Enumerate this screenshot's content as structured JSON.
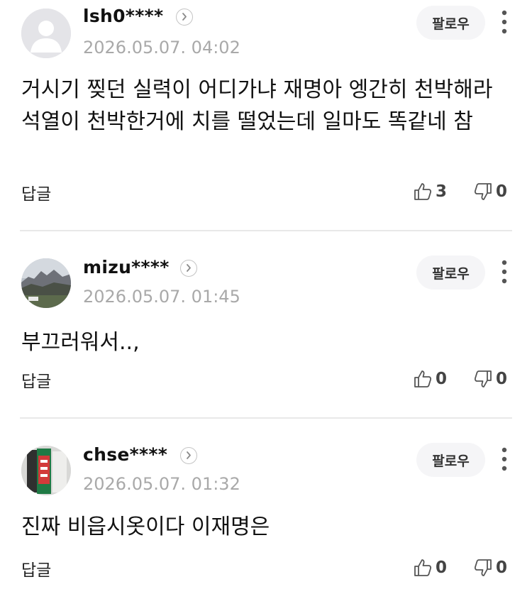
{
  "comments": [
    {
      "username": "lsh0****",
      "timestamp": "2026.05.07. 04:02",
      "follow_label": "팔로우",
      "text": "거시기 찢던 실력이 어디가냐 재명아 엥간히 천박해라 석열이 천박한거에 치를 떨었는데 일마도 똑같네 참",
      "reply_label": "답글",
      "likes": "3",
      "dislikes": "0",
      "avatar": "default-person-icon"
    },
    {
      "username": "mizu****",
      "timestamp": "2026.05.07. 01:45",
      "follow_label": "팔로우",
      "text": "부끄러워서..,",
      "reply_label": "답글",
      "likes": "0",
      "dislikes": "0",
      "avatar": "mountain-photo"
    },
    {
      "username": "chse****",
      "timestamp": "2026.05.07. 01:32",
      "follow_label": "팔로우",
      "text": "진짜 비읍시옷이다 이재명은",
      "reply_label": "답글",
      "likes": "0",
      "dislikes": "0",
      "avatar": "product-photo"
    }
  ],
  "colors": {
    "timestamp": "#a9a9a9",
    "follow_bg": "#f5f5f7",
    "divider": "#e8e8e8"
  }
}
